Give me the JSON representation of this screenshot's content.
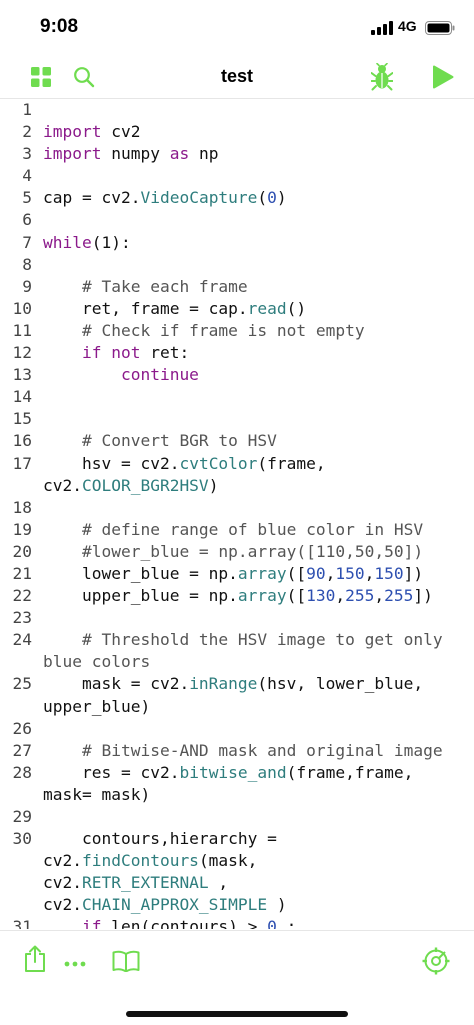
{
  "status": {
    "time": "9:08",
    "network": "4G"
  },
  "nav": {
    "title": "test"
  },
  "colors": {
    "accent": "#6fdc4f",
    "keyword": "#8b1a8b",
    "function": "#2e7d7d",
    "number": "#2d4fb0"
  },
  "icons": [
    "grid-icon",
    "search-icon",
    "bug-icon",
    "play-icon",
    "share-icon",
    "more-icon",
    "book-icon",
    "settings-icon"
  ],
  "lines": [
    {
      "num": "1",
      "segs": []
    },
    {
      "num": "2",
      "segs": [
        {
          "t": "k",
          "v": "import"
        },
        {
          "t": "p",
          "v": " cv2"
        }
      ]
    },
    {
      "num": "3",
      "segs": [
        {
          "t": "k",
          "v": "import"
        },
        {
          "t": "p",
          "v": " numpy "
        },
        {
          "t": "k",
          "v": "as"
        },
        {
          "t": "p",
          "v": " np"
        }
      ]
    },
    {
      "num": "4",
      "segs": []
    },
    {
      "num": "5",
      "segs": [
        {
          "t": "p",
          "v": "cap = cv2."
        },
        {
          "t": "f",
          "v": "VideoCapture"
        },
        {
          "t": "p",
          "v": "("
        },
        {
          "t": "n",
          "v": "0"
        },
        {
          "t": "p",
          "v": ")"
        }
      ]
    },
    {
      "num": "6",
      "segs": []
    },
    {
      "num": "7",
      "segs": [
        {
          "t": "k",
          "v": "while"
        },
        {
          "t": "p",
          "v": "(1):"
        }
      ]
    },
    {
      "num": "8",
      "segs": []
    },
    {
      "num": "9",
      "segs": [
        {
          "t": "c",
          "v": "    # Take each frame"
        }
      ]
    },
    {
      "num": "10",
      "segs": [
        {
          "t": "p",
          "v": "    ret, frame = cap."
        },
        {
          "t": "f",
          "v": "read"
        },
        {
          "t": "p",
          "v": "()"
        }
      ]
    },
    {
      "num": "11",
      "segs": [
        {
          "t": "c",
          "v": "    # Check if frame is not empty"
        }
      ]
    },
    {
      "num": "12",
      "segs": [
        {
          "t": "k",
          "v": "    if not"
        },
        {
          "t": "p",
          "v": " ret:"
        }
      ]
    },
    {
      "num": "13",
      "segs": [
        {
          "t": "k",
          "v": "        continue"
        }
      ]
    },
    {
      "num": "14",
      "segs": []
    },
    {
      "num": "15",
      "segs": []
    },
    {
      "num": "16",
      "segs": [
        {
          "t": "c",
          "v": "    # Convert BGR to HSV"
        }
      ]
    },
    {
      "num": "17",
      "segs": [
        {
          "t": "p",
          "v": "    hsv = cv2."
        },
        {
          "t": "f",
          "v": "cvtColor"
        },
        {
          "t": "p",
          "v": "(frame,"
        }
      ]
    },
    {
      "num": "",
      "segs": [
        {
          "t": "p",
          "v": "cv2."
        },
        {
          "t": "f",
          "v": "COLOR_BGR2HSV"
        },
        {
          "t": "p",
          "v": ")"
        }
      ]
    },
    {
      "num": "18",
      "segs": []
    },
    {
      "num": "19",
      "segs": [
        {
          "t": "c",
          "v": "    # define range of blue color in HSV"
        }
      ]
    },
    {
      "num": "20",
      "segs": [
        {
          "t": "c",
          "v": "    #lower_blue = np.array([110,50,50])"
        }
      ]
    },
    {
      "num": "21",
      "segs": [
        {
          "t": "p",
          "v": "    lower_blue = np."
        },
        {
          "t": "f",
          "v": "array"
        },
        {
          "t": "p",
          "v": "(["
        },
        {
          "t": "n",
          "v": "90"
        },
        {
          "t": "p",
          "v": ","
        },
        {
          "t": "n",
          "v": "150"
        },
        {
          "t": "p",
          "v": ","
        },
        {
          "t": "n",
          "v": "150"
        },
        {
          "t": "p",
          "v": "])"
        }
      ]
    },
    {
      "num": "22",
      "segs": [
        {
          "t": "p",
          "v": "    upper_blue = np."
        },
        {
          "t": "f",
          "v": "array"
        },
        {
          "t": "p",
          "v": "(["
        },
        {
          "t": "n",
          "v": "130"
        },
        {
          "t": "p",
          "v": ","
        },
        {
          "t": "n",
          "v": "255"
        },
        {
          "t": "p",
          "v": ","
        },
        {
          "t": "n",
          "v": "255"
        },
        {
          "t": "p",
          "v": "])"
        }
      ]
    },
    {
      "num": "23",
      "segs": []
    },
    {
      "num": "24",
      "segs": [
        {
          "t": "c",
          "v": "    # Threshold the HSV image to get only"
        }
      ]
    },
    {
      "num": "",
      "segs": [
        {
          "t": "c",
          "v": "blue colors"
        }
      ]
    },
    {
      "num": "25",
      "segs": [
        {
          "t": "p",
          "v": "    mask = cv2."
        },
        {
          "t": "f",
          "v": "inRange"
        },
        {
          "t": "p",
          "v": "(hsv, lower_blue,"
        }
      ]
    },
    {
      "num": "",
      "segs": [
        {
          "t": "p",
          "v": "upper_blue)"
        }
      ]
    },
    {
      "num": "26",
      "segs": []
    },
    {
      "num": "27",
      "segs": [
        {
          "t": "c",
          "v": "    # Bitwise-AND mask and original image"
        }
      ]
    },
    {
      "num": "28",
      "segs": [
        {
          "t": "p",
          "v": "    res = cv2."
        },
        {
          "t": "f",
          "v": "bitwise_and"
        },
        {
          "t": "p",
          "v": "(frame,frame,"
        }
      ]
    },
    {
      "num": "",
      "segs": [
        {
          "t": "p",
          "v": "mask= mask)"
        }
      ]
    },
    {
      "num": "29",
      "segs": []
    },
    {
      "num": "30",
      "segs": [
        {
          "t": "p",
          "v": "    contours,hierarchy ="
        }
      ]
    },
    {
      "num": "",
      "segs": [
        {
          "t": "p",
          "v": "cv2."
        },
        {
          "t": "f",
          "v": "findContours"
        },
        {
          "t": "p",
          "v": "(mask,"
        }
      ]
    },
    {
      "num": "",
      "segs": [
        {
          "t": "p",
          "v": "cv2."
        },
        {
          "t": "f",
          "v": "RETR_EXTERNAL"
        },
        {
          "t": "p",
          "v": " ,"
        }
      ]
    },
    {
      "num": "",
      "segs": [
        {
          "t": "p",
          "v": "cv2."
        },
        {
          "t": "f",
          "v": "CHAIN_APPROX_SIMPLE"
        },
        {
          "t": "p",
          "v": " )"
        }
      ]
    },
    {
      "num": "31",
      "segs": [
        {
          "t": "k",
          "v": "    if"
        },
        {
          "t": "p",
          "v": " len(contours) > "
        },
        {
          "t": "n",
          "v": "0"
        },
        {
          "t": "p",
          "v": " :"
        }
      ]
    }
  ]
}
